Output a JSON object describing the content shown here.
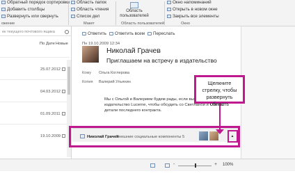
{
  "ribbon": {
    "col1": [
      "Обратный порядок сортировки",
      "Добавить столбцы",
      "Развернуть или свернуть"
    ],
    "col2": [
      "Область папок",
      "Область чтения",
      "Список дел"
    ],
    "people_pane_button": "Область пользователей",
    "col4": [
      "Окно напоминаний",
      "Открыть в новом окне",
      "Закрыть все элементы"
    ],
    "groups": [
      "ожение",
      "Макет",
      "Область пользователей",
      "Окно"
    ]
  },
  "mail_list": {
    "search_placeholder": "ек текущего почтового ящика",
    "col_date": "По Дате",
    "col_new": "Новые",
    "dates": [
      "25.07.2012",
      "04.03.2012",
      "01.09.2011",
      "19.10.2009"
    ]
  },
  "reading_pane": {
    "actions": [
      "Ответить",
      "Ответить всем",
      "Переслать"
    ],
    "sent": "Пн 19.10.2009 12:34",
    "sender": "Николай Грачев",
    "subject": "Приглашаем на встречу в издательство",
    "to_label": "Кому",
    "to_value": "Ольга Коглерова",
    "cc_label": "Копия",
    "cc_value": "Валерий Ульянин",
    "body": "Мы с Ольгой и Валерием будем рады, если вы придете в издательство Lucerne, чтобы обсудить со Светланой и Олегом детали последнего контракта."
  },
  "social_bar": {
    "name": "Николай Грачев",
    "components": "Внешние социальные компоненты 5",
    "expand_glyph": "▲"
  },
  "callout": {
    "text": "Щелкните стрелку, чтобы развернуть область"
  },
  "status_bar": {
    "zoom_minus": "-",
    "zoom_plus": "+",
    "zoom": "100%"
  },
  "colors": {
    "highlight": "#c0188f",
    "accent": "#2b579a"
  }
}
